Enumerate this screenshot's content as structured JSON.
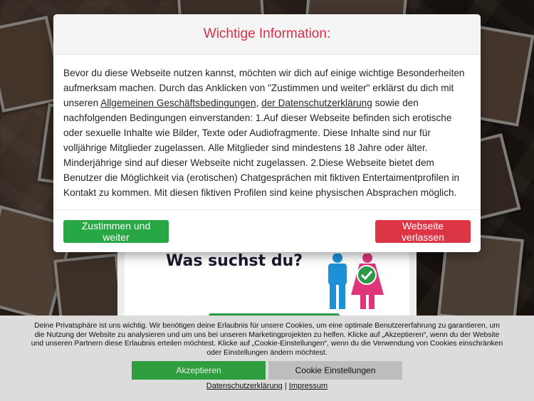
{
  "modal": {
    "title": "Wichtige Information:",
    "body_intro": "Bevor du diese Webseite nutzen kannst, möchten wir dich auf einige wichtige Besonderheiten aufmerksam machen. Durch das Anklicken von \"Zustimmen und weiter\" erklärst du dich mit unseren ",
    "link_agb": "Allgemeinen Geschäftsbedingungen",
    "sep": ", ",
    "link_privacy": "der Datenschutzerklärung",
    "body_rest": " sowie den nachfolgenden Bedingungen einverstanden: 1.Auf dieser Webseite befinden sich erotische oder sexuelle Inhalte wie Bilder, Texte oder Audiofragmente. Diese Inhalte sind nur für volljährige Mitglieder zugelassen. Alle Mitglieder sind mindestens 18 Jahre oder älter. Minderjährige sind auf dieser Webseite nicht zugelassen. 2.Diese Webseite bietet dem Benutzer die Möglichkeit via (erotischen) Chatgesprächen mit fiktiven Entertaimentprofilen in Kontakt zu kommen. Mit diesen fiktiven Profilen sind keine physischen Absprachen möglich.",
    "accept_label": "Zustimmen und weiter",
    "leave_label": "Webseite verlassen"
  },
  "page": {
    "heading": "Was suchst du?",
    "icons": [
      "male-icon",
      "female-icon",
      "checkmark-icon"
    ]
  },
  "cookie": {
    "text": "Deine Privatsphäre ist uns wichtig. Wir benötigen deine Erlaubnis für unsere Cookies, um eine optimale Benutzererfahrung zu garantieren, um die Nutzung der Website zu analysieren und um uns bei unseren Marketingprojekten zu helfen. Klicke auf „Akzeptieren“, wenn du der Website und unseren Partnern diese Erlaubnis erteilen möchtest. Klicke auf „Cookie-Einstellungen“, wenn du die Verwendung von Cookies einschränken oder Einstellungen ändern möchtest.",
    "accept_label": "Akzeptieren",
    "settings_label": "Cookie Einstellungen",
    "privacy_link": "Datenschutzerklärung",
    "separator": " | ",
    "imprint_link": "Impressum"
  },
  "colors": {
    "title_red": "#d9304a",
    "accept_green": "#28a745",
    "leave_red": "#dc3545",
    "male_blue": "#1e90d6",
    "female_pink": "#e0357a"
  }
}
